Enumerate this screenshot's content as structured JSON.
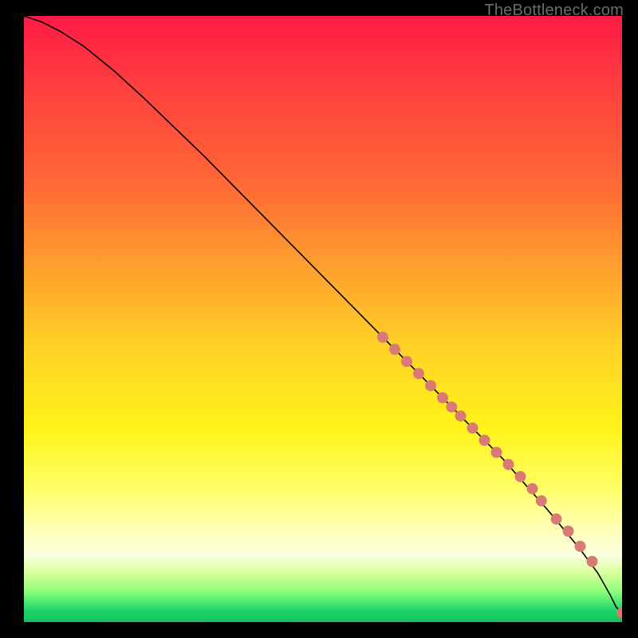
{
  "attribution": "TheBottleneck.com",
  "chart_data": {
    "type": "line",
    "title": "",
    "xlabel": "",
    "ylabel": "",
    "xlim": [
      0,
      100
    ],
    "ylim": [
      0,
      100
    ],
    "grid": false,
    "legend": false,
    "background_gradient": [
      "#ff1a46",
      "#ff6a36",
      "#ffd326",
      "#ffff66",
      "#ffffb0",
      "#1fd76a"
    ],
    "series": [
      {
        "name": "curve",
        "kind": "line",
        "color": "#000000",
        "x": [
          0,
          3,
          6,
          10,
          15,
          20,
          30,
          40,
          50,
          60,
          70,
          80,
          88,
          93,
          96,
          98,
          99,
          100
        ],
        "y": [
          100,
          99,
          97.5,
          95,
          91,
          86.5,
          77,
          67,
          57,
          47,
          37,
          27,
          18,
          12,
          8,
          4.5,
          2.5,
          1.5
        ]
      },
      {
        "name": "points",
        "kind": "scatter",
        "color": "#d97a75",
        "marker_radius": 7,
        "x": [
          60,
          62,
          64,
          66,
          68,
          70,
          71.5,
          73,
          75,
          77,
          79,
          81,
          83,
          85,
          86.5,
          89,
          91,
          93,
          95,
          100
        ],
        "y": [
          47,
          45,
          43,
          41,
          39,
          37,
          35.5,
          34,
          32,
          30,
          28,
          26,
          24,
          22,
          20,
          17,
          15,
          12.5,
          10,
          1.5
        ]
      }
    ]
  }
}
